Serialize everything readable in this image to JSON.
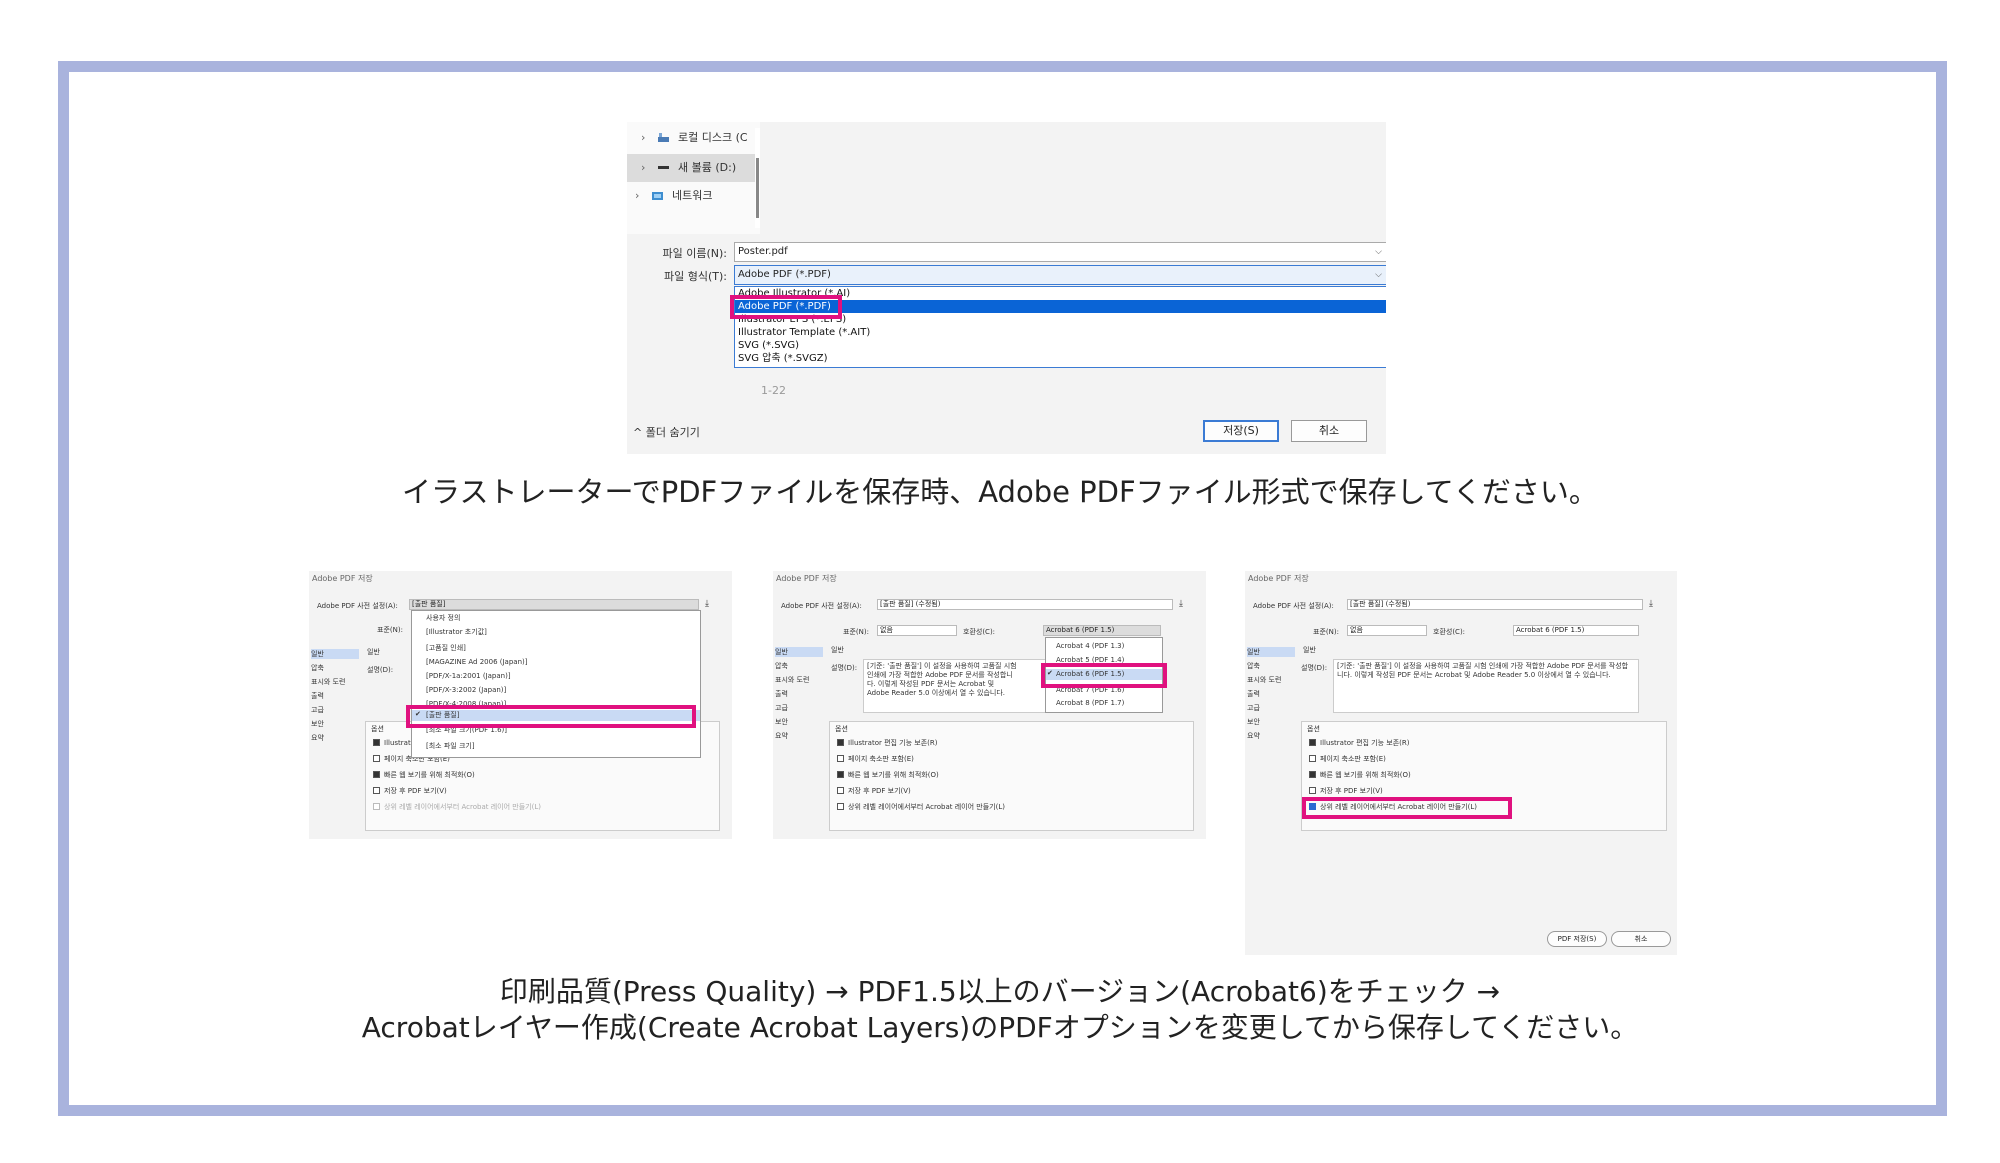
{
  "colors": {
    "frame": "#a9b3dd",
    "highlight": "#e0117f",
    "selection": "#0a64d6"
  },
  "save_dialog": {
    "tree": [
      {
        "label": "로컬 디스크 (C",
        "icon": "drive-icon"
      },
      {
        "label": "새 볼륨 (D:)",
        "icon": "volume-icon"
      },
      {
        "label": "네트워크",
        "icon": "network-icon"
      }
    ],
    "filename_label": "파일 이름(N):",
    "filename_value": "Poster.pdf",
    "filetype_label": "파일 형식(T):",
    "filetype_value": "Adobe PDF (*.PDF)",
    "filetype_options": [
      "Adobe Illustrator (*.AI)",
      "Adobe PDF (*.PDF)",
      "Illustrator EPS (*.EPS)",
      "Illustrator Template (*.AIT)",
      "SVG (*.SVG)",
      "SVG 압축 (*.SVGZ)"
    ],
    "range_value": "1-22",
    "hide_folders": "^ 폴더 숨기기",
    "save_button": "저장(S)",
    "cancel_button": "취소"
  },
  "caption1": "イラストレーターでPDFファイルを保存時、Adobe PDFファイル形式で保存してください。",
  "dialog1": {
    "title": "Adobe PDF 저장",
    "preset_label": "Adobe PDF 사전 설정(A):",
    "preset_value": "[출판 품질]",
    "standard_label": "표준(N):",
    "side": [
      "일반",
      "압축",
      "표시와 도련",
      "출력",
      "고급",
      "보안",
      "요약"
    ],
    "general_label": "일반",
    "desc_label": "설명(D):",
    "presets": [
      "사용자 정의",
      "[Illustrator 초기값]",
      "[고품질 인쇄]",
      "[MAGAZINE Ad 2006 (Japan)]",
      "[PDF/X-1a:2001 (Japan)]",
      "[PDF/X-3:2002 (Japan)]",
      "[PDF/X-4:2008 (Japan)]",
      "[출판 품질]",
      "[최소 파일 크기(PDF 1.6)]",
      "[최소 파일 크기]"
    ],
    "options_label": "옵션",
    "options": [
      "Illustrator 편집 기능 보존(R)",
      "페이지 축소판 포함(E)",
      "빠른 웹 보기를 위해 최적화(O)",
      "저장 후 PDF 보기(V)",
      "상위 레벨 레이어에서부터 Acrobat 레이어 만들기(L)"
    ]
  },
  "dialog2": {
    "title": "Adobe PDF 저장",
    "preset_label": "Adobe PDF 사전 설정(A):",
    "preset_value": "[출판 품질] (수정됨)",
    "standard_label": "표준(N):",
    "standard_value": "없음",
    "compat_label": "호환성(C):",
    "compat_value": "Acrobat 6 (PDF 1.5)",
    "compat_options": [
      "Acrobat 4 (PDF 1.3)",
      "Acrobat 5 (PDF 1.4)",
      "Acrobat 6 (PDF 1.5)",
      "Acrobat 7 (PDF 1.6)",
      "Acrobat 8 (PDF 1.7)"
    ],
    "side": [
      "일반",
      "압축",
      "표시와 도련",
      "출력",
      "고급",
      "보안",
      "요약"
    ],
    "general_label": "일반",
    "desc_label": "설명(D):",
    "desc_text": "[기준: '출판 품질'] 이 설정을 사용하여 고품질 시험 인쇄에 가장 적합한 Adobe PDF 문서를 작성합니다. 이렇게 작성된 PDF 문서는 Acrobat 및 Adobe Reader 5.0 이상에서 열 수 있습니다.",
    "options_label": "옵션",
    "options": [
      "Illustrator 편집 기능 보존(R)",
      "페이지 축소판 포함(E)",
      "빠른 웹 보기를 위해 최적화(O)",
      "저장 후 PDF 보기(V)",
      "상위 레벨 레이어에서부터 Acrobat 레이어 만들기(L)"
    ]
  },
  "dialog3": {
    "title": "Adobe PDF 저장",
    "preset_label": "Adobe PDF 사전 설정(A):",
    "preset_value": "[출판 품질] (수정됨)",
    "standard_label": "표준(N):",
    "standard_value": "없음",
    "compat_label": "호환성(C):",
    "compat_value": "Acrobat 6 (PDF 1.5)",
    "side": [
      "일반",
      "압축",
      "표시와 도련",
      "출력",
      "고급",
      "보안",
      "요약"
    ],
    "general_label": "일반",
    "desc_label": "설명(D):",
    "desc_text": "[기준: '출판 품질'] 이 설정을 사용하여 고품질 시험 인쇄에 가장 적합한 Adobe PDF 문서를 작성합니다. 이렇게 작성된 PDF 문서는 Acrobat 및 Adobe Reader 5.0 이상에서 열 수 있습니다.",
    "options_label": "옵션",
    "options": [
      "Illustrator 편집 기능 보존(R)",
      "페이지 축소판 포함(E)",
      "빠른 웹 보기를 위해 최적화(O)",
      "저장 후 PDF 보기(V)",
      "상위 레벨 레이어에서부터 Acrobat 레이어 만들기(L)"
    ],
    "save_pdf_button": "PDF 저장(S)",
    "cancel_button": "취소"
  },
  "caption2_line1": "印刷品質(Press Quality) → PDF1.5以上のバージョン(Acrobat6)をチェック →",
  "caption2_line2": "Acrobatレイヤー作成(Create Acrobat Layers)のPDFオプションを変更してから保存してください。"
}
